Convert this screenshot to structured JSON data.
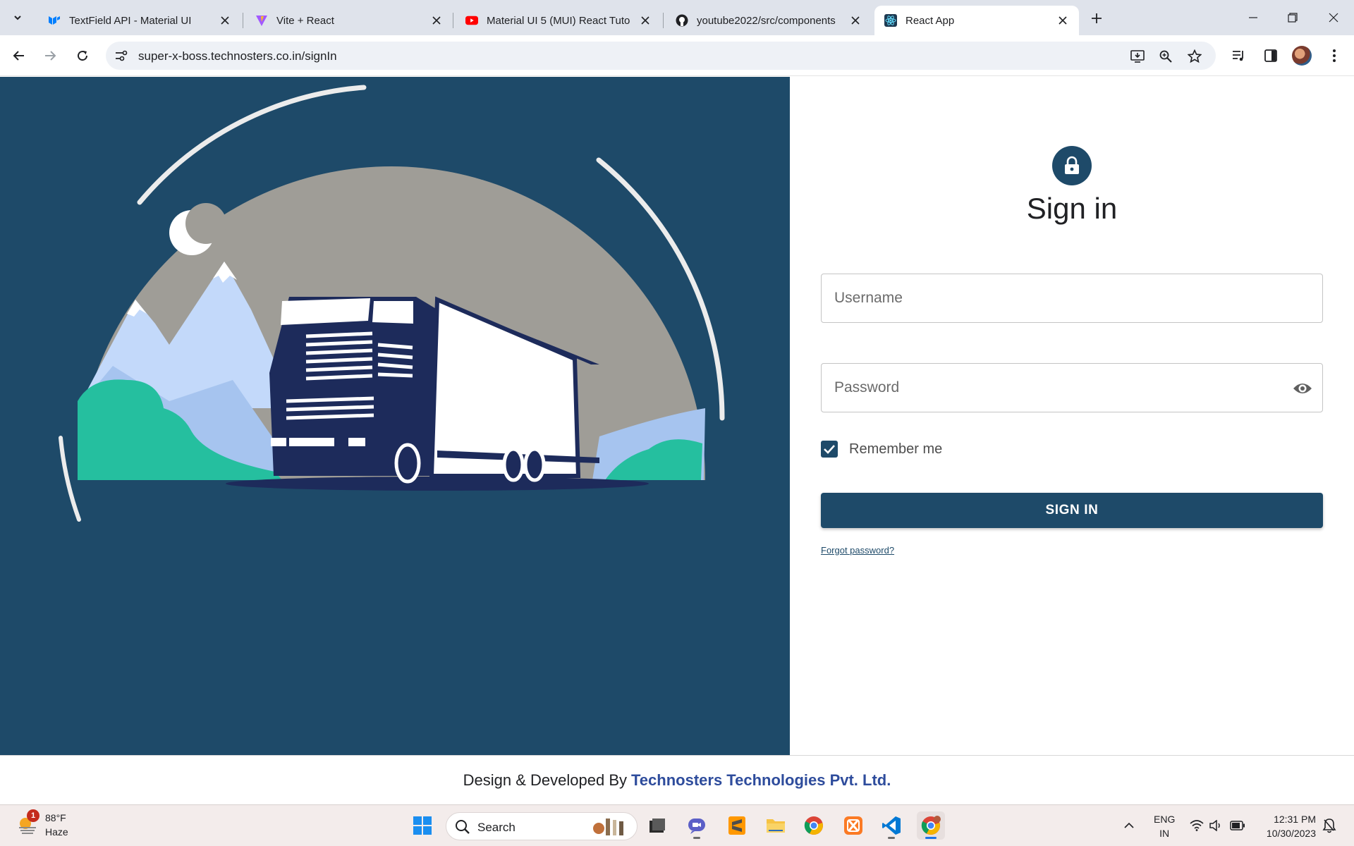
{
  "browser": {
    "tabs": [
      {
        "title": "TextField API - Material UI",
        "favicon": "mui-logo-icon",
        "active": false
      },
      {
        "title": "Vite + React",
        "favicon": "vite-logo-icon",
        "active": false
      },
      {
        "title": "Material UI 5 (MUI) React Tuto",
        "favicon": "youtube-logo-icon",
        "active": false
      },
      {
        "title": "youtube2022/src/components",
        "favicon": "github-logo-icon",
        "active": false
      },
      {
        "title": "React App",
        "favicon": "react-logo-icon",
        "active": true
      }
    ],
    "url": "super-x-boss.technosters.co.in/signIn",
    "colors": {
      "tabstrip": "#dfe3eb",
      "omnibox": "#eef1f6"
    }
  },
  "page": {
    "title": "Sign in",
    "username_placeholder": "Username",
    "password_placeholder": "Password",
    "remember_label": "Remember me",
    "remember_checked": true,
    "signin_button": "SIGN IN",
    "forgot_link": "Forgot password?",
    "footer_prefix": "Design & Developed By",
    "footer_brand": "Technosters Technologies Pvt. Ltd.",
    "colors": {
      "primary": "#1e4a69",
      "brand_link": "#2e4c9c",
      "hero_sky": "#9f9d97",
      "truck": "#1d2b5b",
      "bush": "#25bf9f",
      "mountain": "#c3d9fa"
    }
  },
  "taskbar": {
    "weather": {
      "temp": "88°F",
      "condition": "Haze",
      "badge": "1"
    },
    "search_label": "Search",
    "apps": [
      "windows-start-icon",
      "search-box",
      "file-explorer-icon",
      "teams-chat-icon",
      "sublime-text-icon",
      "folder-icon",
      "chrome-icon",
      "xampp-icon",
      "vscode-icon",
      "chrome-profile-icon"
    ],
    "language": {
      "line1": "ENG",
      "line2": "IN"
    },
    "clock": {
      "time": "12:31 PM",
      "date": "10/30/2023"
    }
  }
}
